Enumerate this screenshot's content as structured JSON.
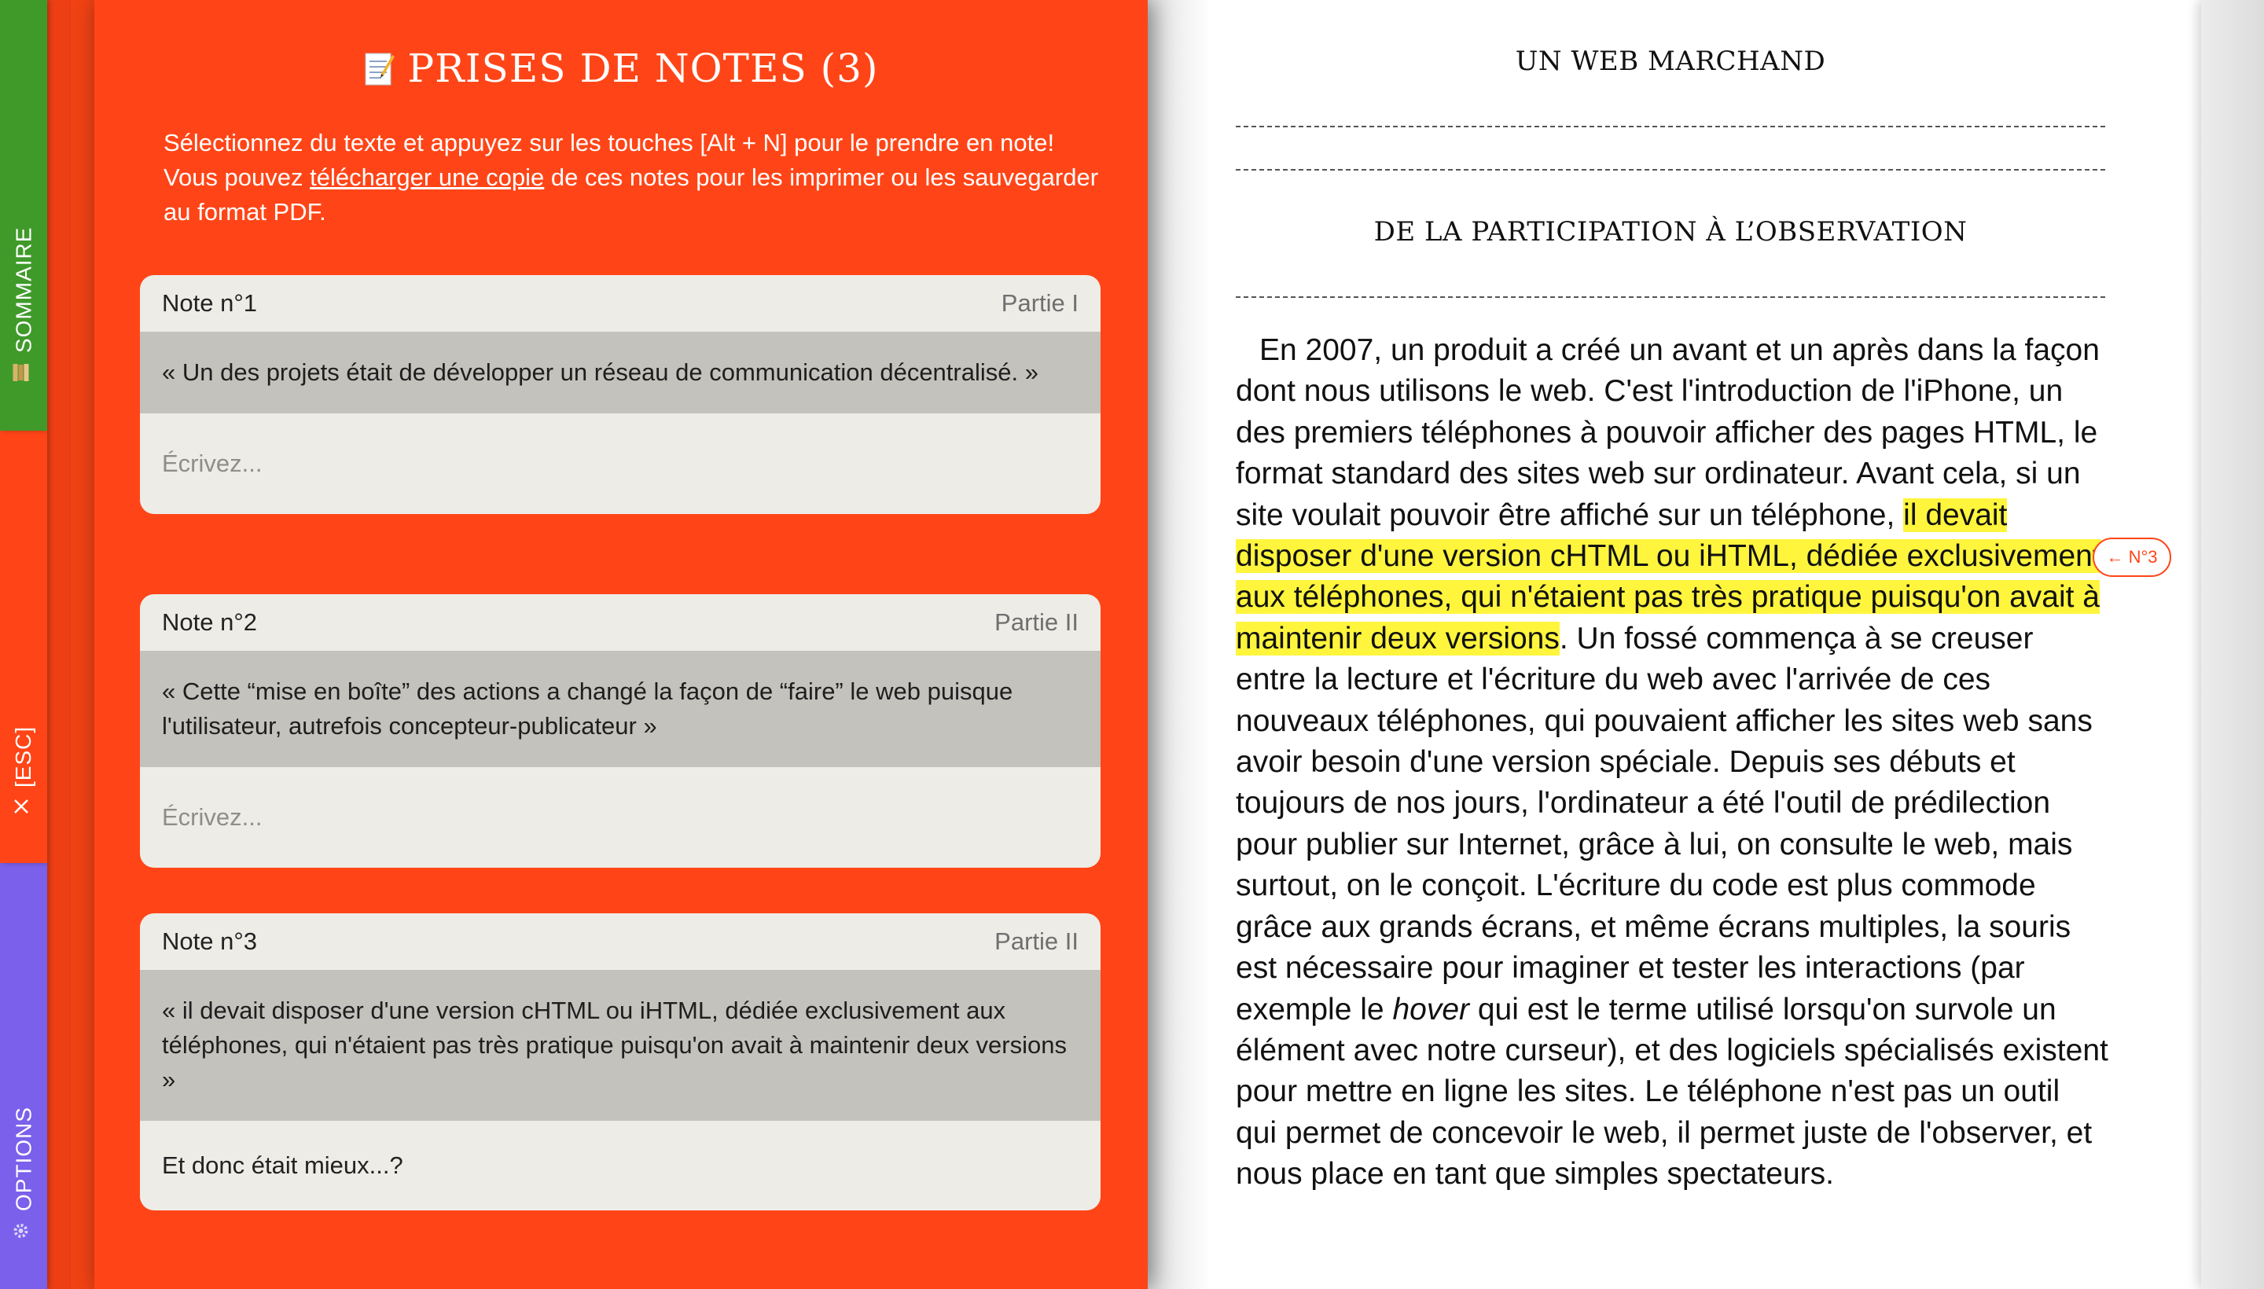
{
  "sidebar": {
    "tabs": [
      {
        "label": "SOMMAIRE",
        "icon": "book-stack-icon",
        "color": "#3f9a2a"
      },
      {
        "label": "[ESC]",
        "icon": "close-icon",
        "color": "#ff4517"
      },
      {
        "label": "OPTIONS",
        "icon": "gear-icon",
        "color": "#7a60ea"
      }
    ]
  },
  "notes": {
    "title_icon": "memo-icon",
    "title": "PRISES DE NOTES (3)",
    "intro_before": "Sélectionnez du texte et appuyez sur les touches [Alt + N] pour le prendre en note! Vous pouvez ",
    "intro_link": "télécharger une copie",
    "intro_after": " de ces notes pour les imprimer ou les sauvegarder au format PDF.",
    "items": [
      {
        "label": "Note n°1",
        "part": "Partie I",
        "quote": "« Un des projets était de développer un réseau de communication décentralisé. »",
        "value": "",
        "placeholder": "Écrivez..."
      },
      {
        "label": "Note n°2",
        "part": "Partie II",
        "quote": "« Cette “mise en boîte” des actions a changé la façon de “faire” le web puisque l'utilisateur, autrefois concepteur-publicateur »",
        "value": "",
        "placeholder": "Écrivez..."
      },
      {
        "label": "Note n°3",
        "part": "Partie II",
        "quote": "« il devait disposer d'une version cHTML ou iHTML, dédiée exclusivement aux téléphones, qui n'étaient pas très pratique puisqu'on avait à maintenir deux versions »",
        "value": "Et donc était mieux...?",
        "placeholder": "Écrivez..."
      }
    ]
  },
  "reader": {
    "running_head": "UN WEB MARCHAND",
    "section_title": "DE LA PARTICIPATION À L’OBSERVATION",
    "para_before": "En 2007, un produit a créé un avant et un après dans la façon dont nous utilisons le web. C'est l'introduction de l'iPhone, un des premiers téléphones à pouvoir afficher des pages HTML, le format standard des sites web sur ordinateur. Avant cela, si un site voulait pouvoir être affiché sur un téléphone, ",
    "para_highlight": "il devait disposer d'une version cHTML ou iHTML, dédiée exclusivement aux téléphones, qui n'étaient pas très pratique puisqu'on avait à maintenir deux versions",
    "para_mid": ". Un fossé commença à se creuser entre la lecture et l'écriture du web avec l'arrivée de ces nouveaux téléphones, qui pouvaient afficher les sites web sans avoir besoin d'une version spéciale. Depuis ses débuts et toujours de nos jours, l'ordinateur a été l'outil de prédilection pour publier sur Internet, grâce à lui, on consulte le web, mais surtout, on le conçoit. L'écriture du code est plus commode grâce aux grands écrans, et même écrans multiples, la souris est nécessaire pour imaginer et tester les interactions (par exemple le ",
    "para_italic": "hover",
    "para_after": " qui est le terme utilisé lorsqu'on survole un élément avec notre curseur), et des logiciels spécialisés existent pour mettre en ligne les sites. Le téléphone n'est pas un outil qui permet de concevoir le web, il permet juste de l'observer, et nous place en tant que simples spectateurs.",
    "note_ref": "← N°3",
    "highlight_color": "#fff53d"
  }
}
